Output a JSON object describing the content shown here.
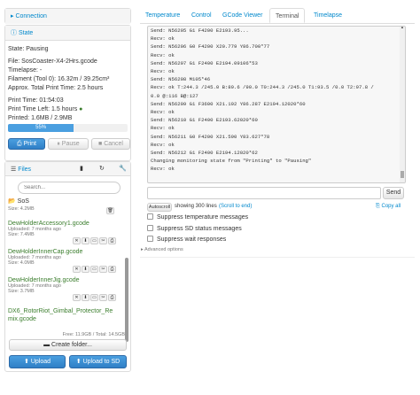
{
  "connection": {
    "title": "Connection"
  },
  "state": {
    "title": "State",
    "state_line": "State: Pausing",
    "file_line": "File: SosCoaster-X4-2Hrs.gcode",
    "timelapse_line": "Timelapse: -",
    "filament_line": "Filament (Tool 0): 16.32m / 39.25cm³",
    "approx_line": "Approx. Total Print Time: 2.5 hours",
    "print_time_line": "Print Time: 01:54:03",
    "print_time_left_line": "Print Time Left: 1.5 hours",
    "printed_line": "Printed: 1.6MB / 2.9MB",
    "progress_label": "55%",
    "progress": 0.55,
    "buttons": {
      "print": "Print",
      "pause": "Pause",
      "cancel": "Cancel"
    }
  },
  "files": {
    "title": "Files",
    "search_placeholder": "Search...",
    "folder": {
      "name": "SoS",
      "size": "Size: 4.2MB"
    },
    "items": [
      {
        "name": "DewHolderAccessory1.gcode",
        "uploaded": "Uploaded: 7 months ago",
        "size": "Size: 7.4MB"
      },
      {
        "name": "DewHolderInnerCap.gcode",
        "uploaded": "Uploaded: 7 months ago",
        "size": "Size: 4.0MB"
      },
      {
        "name": "DewHolderInnerJig.gcode",
        "uploaded": "Uploaded: 7 months ago",
        "size": "Size: 3.7MB"
      },
      {
        "name": "DX6_RotorRiot_Gimbal_Protector_Remix.gcode",
        "uploaded": "",
        "size": ""
      }
    ],
    "free_total": "Free: 11.9GB / Total: 14.5GB",
    "create_folder": "Create folder...",
    "upload": "Upload",
    "upload_sd": "Upload to SD"
  },
  "tabs": [
    "Temperature",
    "Control",
    "GCode Viewer",
    "Terminal",
    "Timelapse"
  ],
  "terminal": {
    "lines": [
      "Send: N56205 G1 F4200 E2193.95...",
      "Recv: ok",
      "Send: N56206 G0 F4200 X20.779 Y86.700*77",
      "Recv: ok",
      "Send: N56207 G1 F2400 E2194.09106*53",
      "Recv: ok",
      "Send: N56208 M105*46",
      "Recv: ok T:244.3 /245.0 B:89.6 /90.0 T0:244.3 /245.0 T1:93.5 /0.0 T2:97.8 /",
      "0.0 @:116 B@:127",
      "Send: N56209 G1 F3600 X21.192 Y86.287 E2194.12020*60",
      "Recv: ok",
      "Send: N56210 G1 F2400 E2193.62020*60",
      "Recv: ok",
      "Send: N56211 G0 F4200 X21.590 Y83.627*78",
      "Recv: ok",
      "Send: N56212 G1 F2400 E2194.12020*62",
      "Changing monitoring state from \"Printing\" to \"Pausing\"",
      "Recv: ok"
    ],
    "send": "Send",
    "autoscroll": "Autoscroll",
    "showing": "showing 300 lines",
    "scroll_to_end": "(Scroll to end)",
    "copy_all": "Copy all",
    "checks": [
      "Suppress temperature messages",
      "Suppress SD status messages",
      "Suppress wait responses"
    ],
    "advanced": "Advanced options"
  },
  "colors": {
    "accent": "#0088cc",
    "progress": "#4a9fe0",
    "file_green": "#3a7d2c"
  }
}
